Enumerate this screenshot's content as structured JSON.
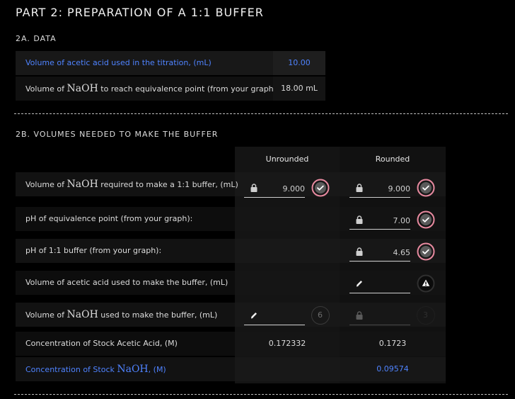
{
  "part_title": "PART 2: PREPARATION OF A 1:1 BUFFER",
  "section_a": {
    "title": "2A. DATA",
    "rows": [
      {
        "label": "Volume of acetic acid used in the titration, (mL)",
        "value": "10.00"
      },
      {
        "label_pre": "Volume of ",
        "label_chem": "NaOH",
        "label_post": " to reach equivalence point (from your graph)",
        "value": "18.00 mL"
      }
    ]
  },
  "section_b": {
    "title": "2B. VOLUMES NEEDED TO MAKE THE BUFFER",
    "col_unrounded": "Unrounded",
    "col_rounded": "Rounded",
    "rows": [
      {
        "label_pre": "Volume of ",
        "label_chem": "NaOH",
        "label_post": " required to make a 1:1 buffer, (mL)",
        "unrounded": "9.000",
        "rounded": "9.000"
      },
      {
        "label": "pH of equivalence point (from your graph):",
        "rounded": "7.00"
      },
      {
        "label": "pH of 1:1 buffer (from your graph):",
        "rounded": "4.65"
      },
      {
        "label": "Volume of acetic acid used to make the buffer, (mL)",
        "rounded": ""
      },
      {
        "label_pre": "Volume of ",
        "label_chem": "NaOH",
        "label_post": " used to make the buffer, (mL)",
        "unrounded": "",
        "attempts_unrounded": "6",
        "rounded": "",
        "attempts_rounded": "3"
      },
      {
        "label": "Concentration of Stock Acetic Acid, (M)",
        "unrounded": "0.172332",
        "rounded": "0.1723"
      },
      {
        "label_pre": "Concentration of Stock ",
        "label_chem": "NaOH",
        "label_post": ", (M)",
        "rounded": "0.09574"
      }
    ]
  },
  "colors": {
    "accent_blue": "#4f83ff",
    "check_ring": "#e88aa0",
    "warn_ring": "#c9a227"
  },
  "icons": [
    "lock-icon",
    "pencil-icon",
    "check-icon",
    "warning-icon"
  ]
}
